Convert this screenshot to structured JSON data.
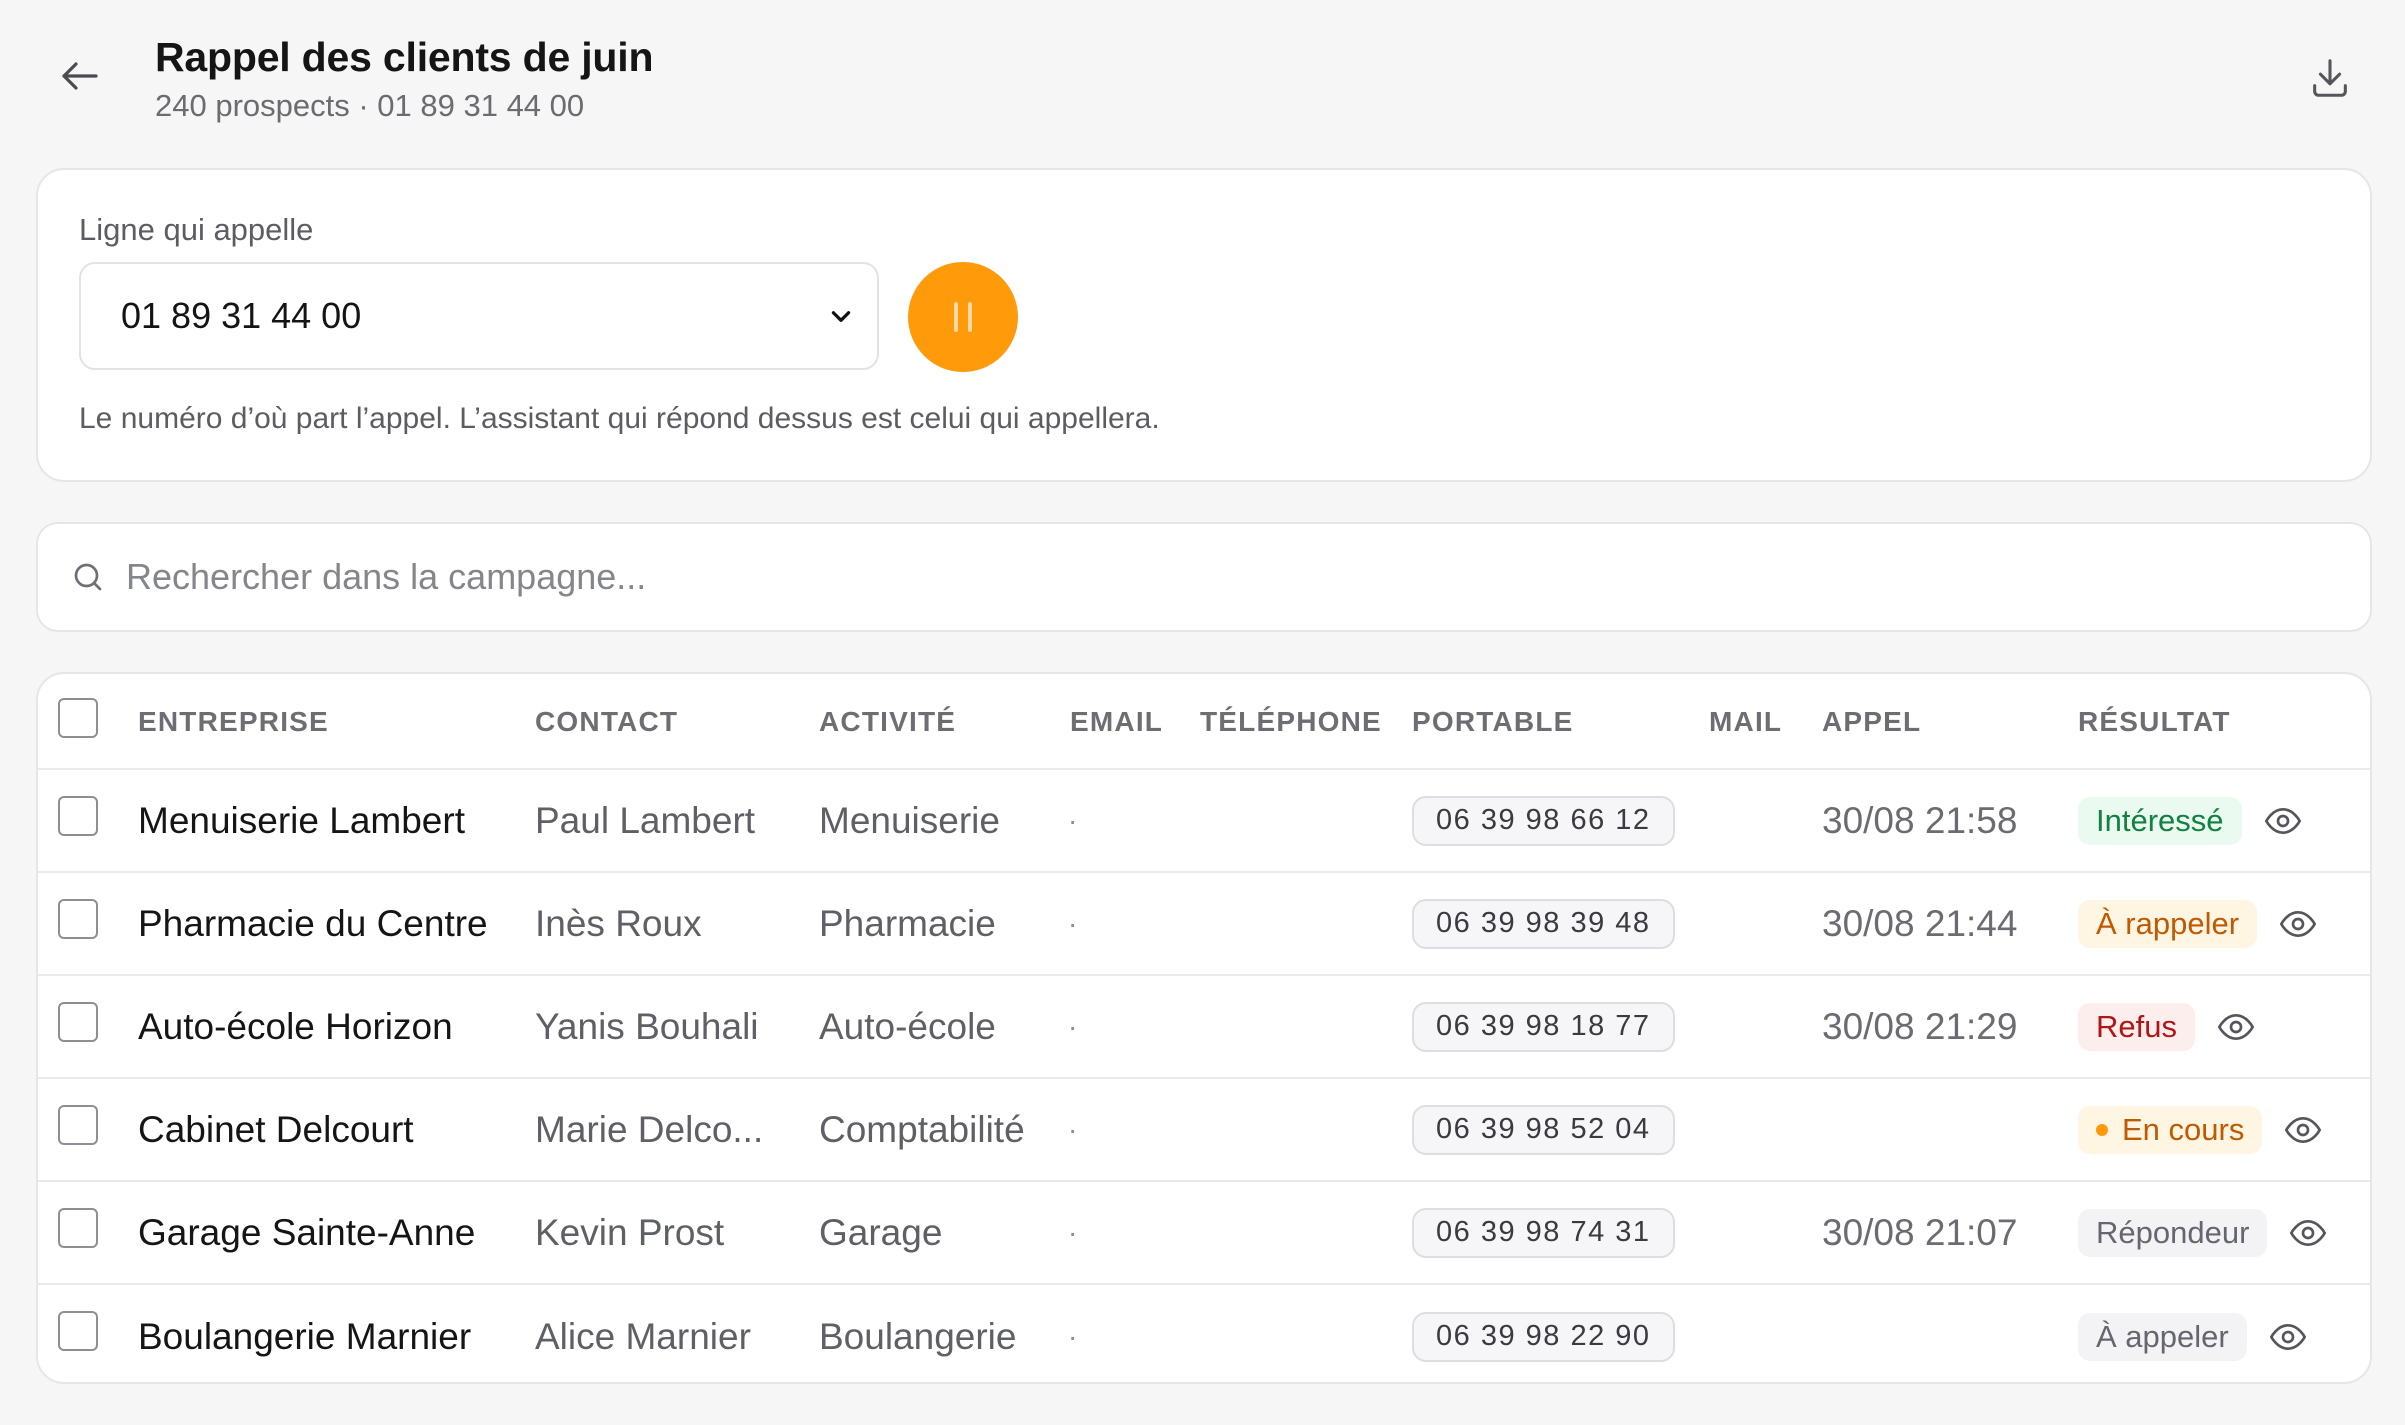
{
  "header": {
    "title": "Rappel des clients de juin",
    "subtitle": "240 prospects · 01 89 31 44 00"
  },
  "line": {
    "label": "Ligne qui appelle",
    "selected": "01 89 31 44 00",
    "help": "Le numéro d’où part l’appel. L’assistant qui répond dessus est celui qui appellera.",
    "pause_color": "#ff9a0a"
  },
  "search": {
    "placeholder": "Rechercher dans la campagne..."
  },
  "table": {
    "columns": {
      "company": "ENTREPRISE",
      "contact": "CONTACT",
      "activity": "ACTIVITÉ",
      "email": "EMAIL",
      "phone": "TÉLÉPHONE",
      "mobile": "PORTABLE",
      "mail": "MAIL",
      "call": "APPEL",
      "result": "RÉSULTAT"
    },
    "rows": [
      {
        "company": "Menuiserie Lambert",
        "contact": "Paul Lambert",
        "activity": "Menuiserie",
        "email": "·",
        "mobile": "06 39 98 66 12",
        "call": "30/08 21:58",
        "result": "Intéressé",
        "result_kind": "green"
      },
      {
        "company": "Pharmacie du Centre",
        "contact": "Inès Roux",
        "activity": "Pharmacie",
        "email": "·",
        "mobile": "06 39 98 39 48",
        "call": "30/08 21:44",
        "result": "À rappeler",
        "result_kind": "amber"
      },
      {
        "company": "Auto-école Horizon",
        "contact": "Yanis Bouhali",
        "activity": "Auto-école",
        "email": "·",
        "mobile": "06 39 98 18 77",
        "call": "30/08 21:29",
        "result": "Refus",
        "result_kind": "red"
      },
      {
        "company": "Cabinet Delcourt",
        "contact": "Marie Delco...",
        "activity": "Comptabilité",
        "email": "·",
        "mobile": "06 39 98 52 04",
        "call": "",
        "result": "En cours",
        "result_kind": "amber-dot"
      },
      {
        "company": "Garage Sainte-Anne",
        "contact": "Kevin Prost",
        "activity": "Garage",
        "email": "·",
        "mobile": "06 39 98 74 31",
        "call": "30/08 21:07",
        "result": "Répondeur",
        "result_kind": "gray"
      },
      {
        "company": "Boulangerie Marnier",
        "contact": "Alice Marnier",
        "activity": "Boulangerie",
        "email": "·",
        "mobile": "06 39 98 22 90",
        "call": "",
        "result": "À appeler",
        "result_kind": "gray"
      }
    ]
  },
  "icons": {
    "back": "arrow-left-icon",
    "download": "download-icon",
    "chevron": "chevron-down-icon",
    "pause": "pause-icon",
    "search": "search-icon",
    "view": "eye-icon"
  }
}
